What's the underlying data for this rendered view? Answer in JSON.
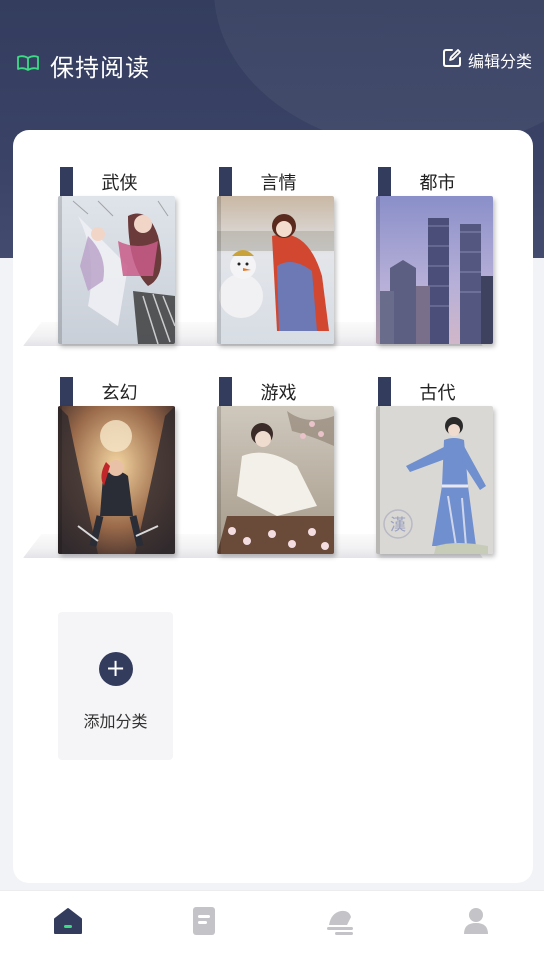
{
  "header": {
    "title": "保持阅读",
    "title_icon": "open-book-icon",
    "edit_label": "编辑分类",
    "edit_icon": "edit-square-icon"
  },
  "categories": [
    {
      "label": "武侠",
      "cover": "wuxia-cover-illustration"
    },
    {
      "label": "言情",
      "cover": "romance-cover-illustration"
    },
    {
      "label": "都市",
      "cover": "city-skyline-cover"
    },
    {
      "label": "玄幻",
      "cover": "fantasy-cover-illustration"
    },
    {
      "label": "游戏",
      "cover": "game-cover-illustration"
    },
    {
      "label": "古代",
      "cover": "ancient-cover-illustration"
    }
  ],
  "add_category": {
    "label": "添加分类",
    "icon": "plus-icon"
  },
  "cover_watermark": "漢",
  "tabbar": [
    {
      "name": "home",
      "icon": "home-icon",
      "active": true
    },
    {
      "name": "book",
      "icon": "document-icon",
      "active": false
    },
    {
      "name": "write",
      "icon": "write-icon",
      "active": false
    },
    {
      "name": "profile",
      "icon": "user-icon",
      "active": false
    }
  ],
  "colors": {
    "header_bg": "#343d5e",
    "accent_green": "#3ddc84",
    "label_stripe": "#343c5e",
    "tab_active": "#343c5e",
    "tab_inactive": "#c4c4c8"
  }
}
